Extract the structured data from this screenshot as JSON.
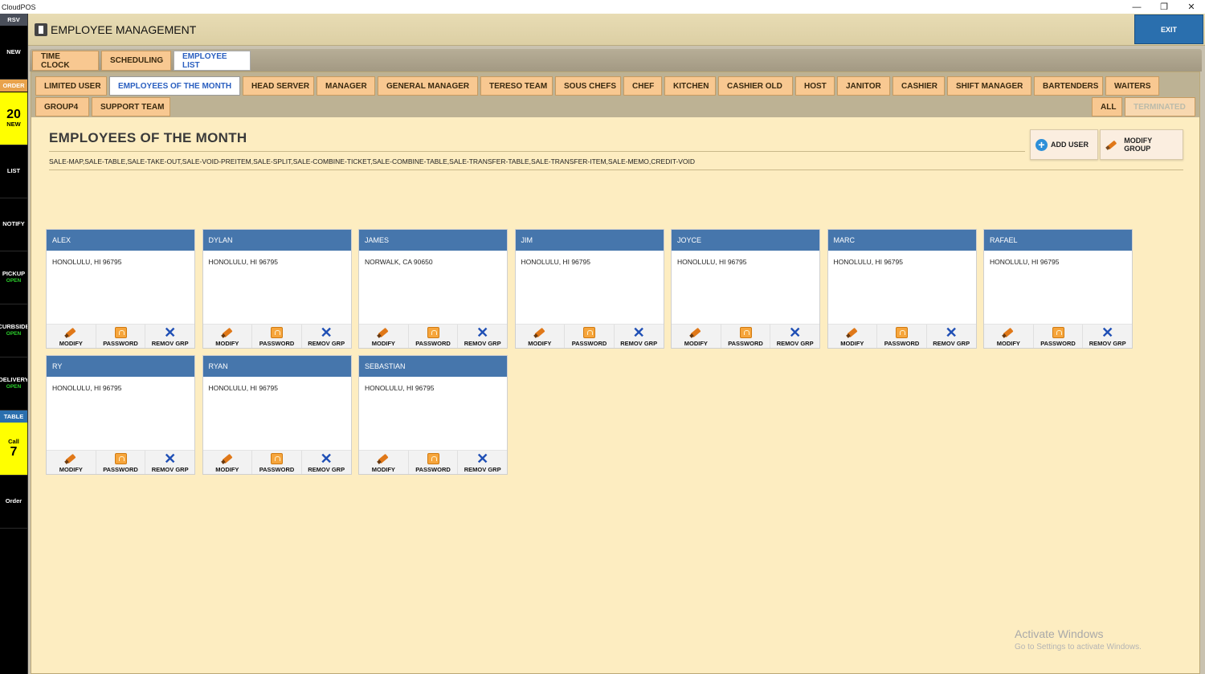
{
  "app": {
    "title": "CloudPOS"
  },
  "window": {
    "minimize": "—",
    "maximize": "❐",
    "close": "✕"
  },
  "sidebar": {
    "rsv": "RSV",
    "new": "NEW",
    "order": "ORDER",
    "order_count": "20",
    "order_count_label": "NEW",
    "list": "LIST",
    "notify": "NOTIFY",
    "pickup": "PICKUP",
    "pickup_status": "OPEN",
    "curbside": "CURBSIDE",
    "curbside_status": "OPEN",
    "delivery": "DELIVERY",
    "delivery_status": "OPEN",
    "table": "TABLE",
    "call": "Call",
    "call_count": "7",
    "order_btn": "Order"
  },
  "header": {
    "title": "EMPLOYEE MANAGEMENT",
    "exit": "EXIT"
  },
  "top_tabs": [
    "TIME CLOCK",
    "SCHEDULING",
    "EMPLOYEE LIST"
  ],
  "group_tabs_row1": [
    "LIMITED USER",
    "EMPLOYEES OF THE MONTH",
    "HEAD SERVER",
    "MANAGER",
    "GENERAL MANAGER",
    "TERESO TEAM",
    "SOUS CHEFS",
    "CHEF",
    "KITCHEN",
    "CASHIER OLD",
    "HOST",
    "JANITOR",
    "CASHIER",
    "SHIFT MANAGER",
    "BARTENDERS",
    "WAITERS"
  ],
  "group_tabs_row2": [
    "GROUP4",
    "SUPPORT TEAM"
  ],
  "filter_tabs": {
    "all": "ALL",
    "terminated": "TERMINATED"
  },
  "group": {
    "title": "EMPLOYEES OF THE MONTH",
    "permissions": "SALE-MAP,SALE-TABLE,SALE-TAKE-OUT,SALE-VOID-PREITEM,SALE-SPLIT,SALE-COMBINE-TICKET,SALE-COMBINE-TABLE,SALE-TRANSFER-TABLE,SALE-TRANSFER-ITEM,SALE-MEMO,CREDIT-VOID",
    "add_user": "ADD USER",
    "modify_group": "MODIFY GROUP"
  },
  "card_actions": {
    "modify": "MODIFY",
    "password": "PASSWORD",
    "remove": "REMOV GRP"
  },
  "employees": [
    {
      "name": "ALEX",
      "address": "HONOLULU, HI 96795"
    },
    {
      "name": "DYLAN",
      "address": "HONOLULU, HI 96795"
    },
    {
      "name": "JAMES",
      "address": "NORWALK, CA 90650"
    },
    {
      "name": "JIM",
      "address": "HONOLULU, HI 96795"
    },
    {
      "name": "JOYCE",
      "address": "HONOLULU, HI 96795"
    },
    {
      "name": "MARC",
      "address": "HONOLULU, HI 96795"
    },
    {
      "name": "RAFAEL",
      "address": "HONOLULU, HI 96795"
    },
    {
      "name": "RY",
      "address": "HONOLULU, HI 96795"
    },
    {
      "name": "RYAN",
      "address": "HONOLULU, HI 96795"
    },
    {
      "name": "SEBASTIAN",
      "address": "HONOLULU, HI 96795"
    }
  ],
  "watermark": {
    "line1": "Activate Windows",
    "line2": "Go to Settings to activate Windows."
  }
}
